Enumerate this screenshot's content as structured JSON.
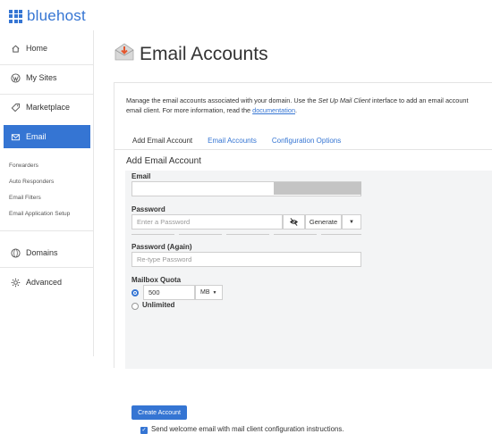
{
  "brand": {
    "name": "bluehost",
    "color": "#3575d3"
  },
  "sidebar": {
    "items": [
      {
        "label": "Home",
        "icon": "home-icon"
      },
      {
        "label": "My Sites",
        "icon": "wordpress-icon"
      },
      {
        "label": "Marketplace",
        "icon": "tag-icon"
      },
      {
        "label": "Email",
        "icon": "envelope-icon",
        "active": true
      }
    ],
    "sub_items": [
      "Forwarders",
      "Auto Responders",
      "Email Filters",
      "Email Application Setup"
    ],
    "bottom_items": [
      {
        "label": "Domains",
        "icon": "globe-icon"
      },
      {
        "label": "Advanced",
        "icon": "gear-icon"
      }
    ]
  },
  "page": {
    "title": "Email Accounts",
    "desc_part1": "Manage the email accounts associated with your domain. Use the ",
    "desc_italic": "Set Up Mail Client",
    "desc_part2": " interface to add an email account",
    "desc_part3": "email client. For more information, read the ",
    "desc_link": "documentation",
    "desc_end": "."
  },
  "tabs": [
    "Add Email Account",
    "Email Accounts",
    "Configuration Options"
  ],
  "form": {
    "section_title": "Add Email Account",
    "email_label": "Email",
    "email_value": "",
    "password_label": "Password",
    "password_placeholder": "Enter a Password",
    "generate_label": "Generate",
    "password_again_label": "Password (Again)",
    "password_again_placeholder": "Re-type Password",
    "quota_label": "Mailbox Quota",
    "quota_value": "500",
    "quota_unit": "MB",
    "unlimited_label": "Unlimited",
    "create_button": "Create Account",
    "welcome_label": "Send welcome email with mail client configuration instructions."
  }
}
